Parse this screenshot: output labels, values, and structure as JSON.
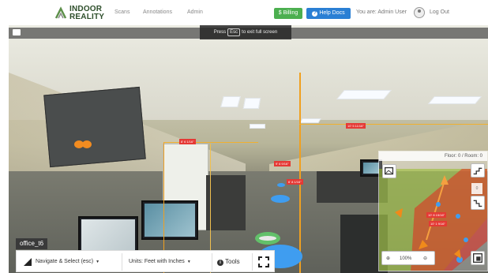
{
  "nav": {
    "logo_line1": "INDOOR",
    "logo_line2": "REALITY",
    "links": [
      "Scans",
      "Annotations",
      "Admin"
    ],
    "billing_label": "$ Billing",
    "help_label": "Help Docs",
    "user_text": "You are: Admin User",
    "logout_label": "Log Out",
    "colors": {
      "billing": "#4caf50",
      "help": "#2a7fd4"
    }
  },
  "viewer": {
    "exit_hint_before": "Press",
    "exit_key": "Esc",
    "exit_hint_after": "to exit full screen",
    "room_label": "office_t6",
    "measurements": [
      "8' 6 1/16\"",
      "10' 5 11/16\"",
      "9' 6 9/16\"",
      "6' 8 1/16\""
    ]
  },
  "toolbar": {
    "navigate_label": "Navigate & Select (esc)",
    "units_label": "Units: Feet with Inches",
    "tools_label": "Tools",
    "icons": [
      "navigate-icon",
      "caret-icon",
      "info-icon",
      "grid-icon"
    ]
  },
  "minimap": {
    "header": "Floor: 0 / Room: 0",
    "measurements": [
      "10' 8 15/16\"",
      "10' 1 9/16\""
    ],
    "side_label": "0",
    "zoom_label": "100%"
  }
}
